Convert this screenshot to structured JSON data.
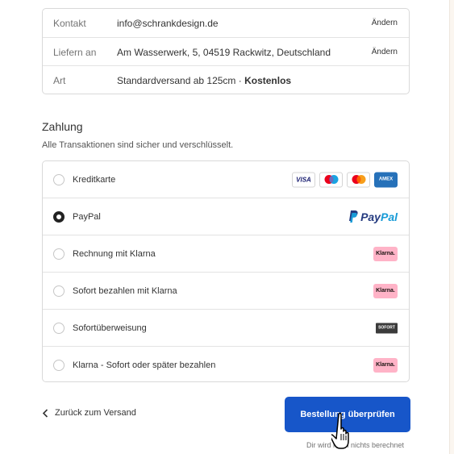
{
  "summary": {
    "rows": [
      {
        "label": "Kontakt",
        "value": "info@schrankdesign.de",
        "action": "Ändern"
      },
      {
        "label": "Liefern an",
        "value": "Am Wasserwerk, 5, 04519 Rackwitz, Deutschland",
        "action": "Ändern"
      },
      {
        "label": "Art",
        "value": "Standardversand ab 125cm · ",
        "value_strong": "Kostenlos"
      }
    ]
  },
  "payment": {
    "title": "Zahlung",
    "subtitle": "Alle Transaktionen sind sicher und verschlüsselt.",
    "methods": [
      {
        "label": "Kreditkarte",
        "selected": false,
        "logos": [
          "visa-logo",
          "maestro-logo",
          "mastercard-logo",
          "amex-logo"
        ]
      },
      {
        "label": "PayPal",
        "selected": true,
        "logos": [
          "paypal-logo"
        ]
      },
      {
        "label": "Rechnung mit Klarna",
        "selected": false,
        "logos": [
          "klarna-logo"
        ]
      },
      {
        "label": "Sofort bezahlen mit Klarna",
        "selected": false,
        "logos": [
          "klarna-logo"
        ]
      },
      {
        "label": "Sofortüberweisung",
        "selected": false,
        "logos": [
          "sofort-logo"
        ]
      },
      {
        "label": "Klarna - Sofort oder später bezahlen",
        "selected": false,
        "logos": [
          "klarna-logo"
        ]
      }
    ],
    "logo_text": {
      "visa": "VISA",
      "amex": "AMEX",
      "paypal_1": "Pay",
      "paypal_2": "Pal",
      "klarna": "Klarna.",
      "sofort": "SOFORT"
    }
  },
  "footer": {
    "back_label": "Zurück zum Versand",
    "submit_label": "Bestellung überprüfen",
    "note": "Dir wird noch nichts berechnet"
  },
  "colors": {
    "primary_button": "#1756c9",
    "klarna_pink": "#ffb3c7",
    "paypal_dark": "#253b80",
    "paypal_light": "#179bd7"
  }
}
